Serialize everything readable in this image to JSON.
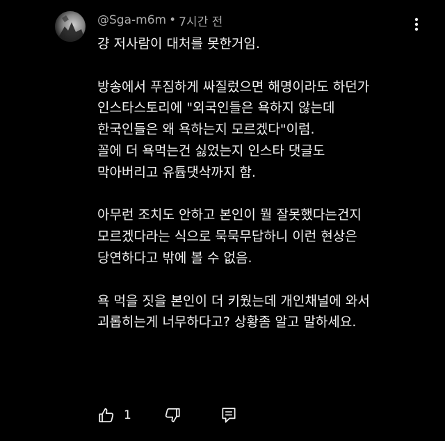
{
  "comment": {
    "author": "@Sga-m6m",
    "separator": "•",
    "timestamp": "7시간 전",
    "body_lines": [
      "걍 저사람이 대처를 못한거임.",
      "",
      "방송에서 푸짐하게 싸질렀으면 해명이라도 하던가",
      "인스타스토리에 \"외국인들은 욕하지 않는데",
      "한국인들은 왜 욕하는지 모르겠다\"이럼.",
      "꼴에 더 욕먹는건 싫었는지 인스타 댓글도",
      "막아버리고 유튭댓삭까지 함.",
      "",
      "아무런 조치도 안하고 본인이 뭘 잘못했다는건지",
      "모르겠다라는 식으로 묵묵무답하니 이런 현상은",
      "당연하다고 밖에 볼 수 없음.",
      "",
      "욕 먹을 짓을 본인이 더 키웠는데 개인채널에 와서",
      "괴롭히는게 너무하다고? 상황좀 알고 말하세요."
    ],
    "like_count": "1",
    "icons": {
      "avatar": "avatar",
      "more": "more-vert-icon",
      "like": "thumbs-up-icon",
      "dislike": "thumbs-down-icon",
      "reply": "reply-comment-icon"
    }
  },
  "colors": {
    "background": "#000000",
    "text_primary": "#f1f1f1",
    "text_secondary": "#aaaaaa"
  }
}
